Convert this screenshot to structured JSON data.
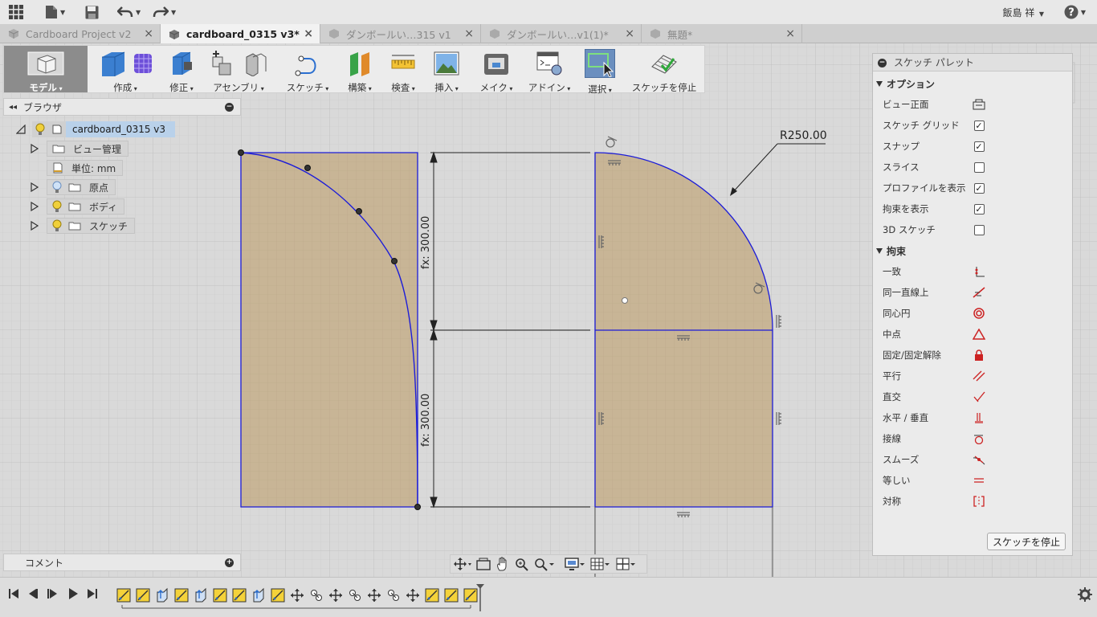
{
  "colors": {
    "sketch_fill": "#c8b596",
    "sketch_line": "#1d1dd8",
    "accent_select": "#6b8fbf",
    "tab_active_bg": "#f2f2f2",
    "constraint_red": "#cc2222"
  },
  "topbar": {
    "icons": [
      "grid-icon",
      "file-icon",
      "save-icon",
      "undo-icon",
      "redo-icon"
    ],
    "user_name": "飯島 祥",
    "help_icon": "question-icon"
  },
  "tabs": [
    {
      "label": "Cardboard Project v2",
      "active": false
    },
    {
      "label": "cardboard_0315 v3*",
      "active": true
    },
    {
      "label": "ダンボールい…315 v1",
      "active": false
    },
    {
      "label": "ダンボールい…v1(1)*",
      "active": false
    },
    {
      "label": "無題*",
      "active": false
    }
  ],
  "tab_close": "×",
  "toolbar": {
    "model": "モデル",
    "create": "作成",
    "modify": "修正",
    "assemble": "アセンブリ",
    "sketch": "スケッチ",
    "construct": "構築",
    "inspect": "検査",
    "insert": "挿入",
    "make": "メイク",
    "addins": "アドイン",
    "select": "選択",
    "stop_sketch": "スケッチを停止"
  },
  "browser": {
    "title": "ブラウザ",
    "root": "cardboard_0315 v3",
    "items": [
      {
        "label": "ビュー管理"
      },
      {
        "label": "単位: mm"
      },
      {
        "label": "原点"
      },
      {
        "label": "ボディ"
      },
      {
        "label": "スケッチ"
      }
    ]
  },
  "comments": {
    "title": "コメント"
  },
  "sketch": {
    "dim_top": "fx: 300.00",
    "dim_bottom": "fx: 300.00",
    "radius": "R250.00"
  },
  "palette": {
    "title": "スケッチ パレット",
    "options_header": "オプション",
    "options": [
      {
        "label": "ビュー正面",
        "type": "icon",
        "icon": "view-face-icon"
      },
      {
        "label": "スケッチ グリッド",
        "type": "check",
        "checked": true
      },
      {
        "label": "スナップ",
        "type": "check",
        "checked": true
      },
      {
        "label": "スライス",
        "type": "check",
        "checked": false
      },
      {
        "label": "プロファイルを表示",
        "type": "check",
        "checked": true
      },
      {
        "label": "拘束を表示",
        "type": "check",
        "checked": true
      },
      {
        "label": "3D スケッチ",
        "type": "check",
        "checked": false
      }
    ],
    "constraints_header": "拘束",
    "constraints": [
      {
        "label": "一致",
        "icon": "coincident-icon"
      },
      {
        "label": "同一直線上",
        "icon": "collinear-icon"
      },
      {
        "label": "同心円",
        "icon": "concentric-icon"
      },
      {
        "label": "中点",
        "icon": "midpoint-icon"
      },
      {
        "label": "固定/固定解除",
        "icon": "lock-icon"
      },
      {
        "label": "平行",
        "icon": "parallel-icon"
      },
      {
        "label": "直交",
        "icon": "perpendicular-icon"
      },
      {
        "label": "水平 / 垂直",
        "icon": "horizontal-vertical-icon"
      },
      {
        "label": "接線",
        "icon": "tangent-icon"
      },
      {
        "label": "スムーズ",
        "icon": "smooth-icon"
      },
      {
        "label": "等しい",
        "icon": "equal-icon"
      },
      {
        "label": "対称",
        "icon": "symmetry-icon"
      }
    ],
    "stop_button": "スケッチを停止"
  },
  "timeline": {
    "controls": [
      "skip-start-icon",
      "step-back-icon",
      "play-icon",
      "step-forward-icon",
      "skip-end-icon"
    ],
    "features": [
      "sketch",
      "sketch",
      "extrude",
      "sketch",
      "extrude",
      "sketch",
      "sketch",
      "extrude",
      "sketch",
      "move",
      "joint",
      "move",
      "joint",
      "move",
      "joint",
      "move",
      "sketch",
      "sketch",
      "sketch"
    ]
  }
}
